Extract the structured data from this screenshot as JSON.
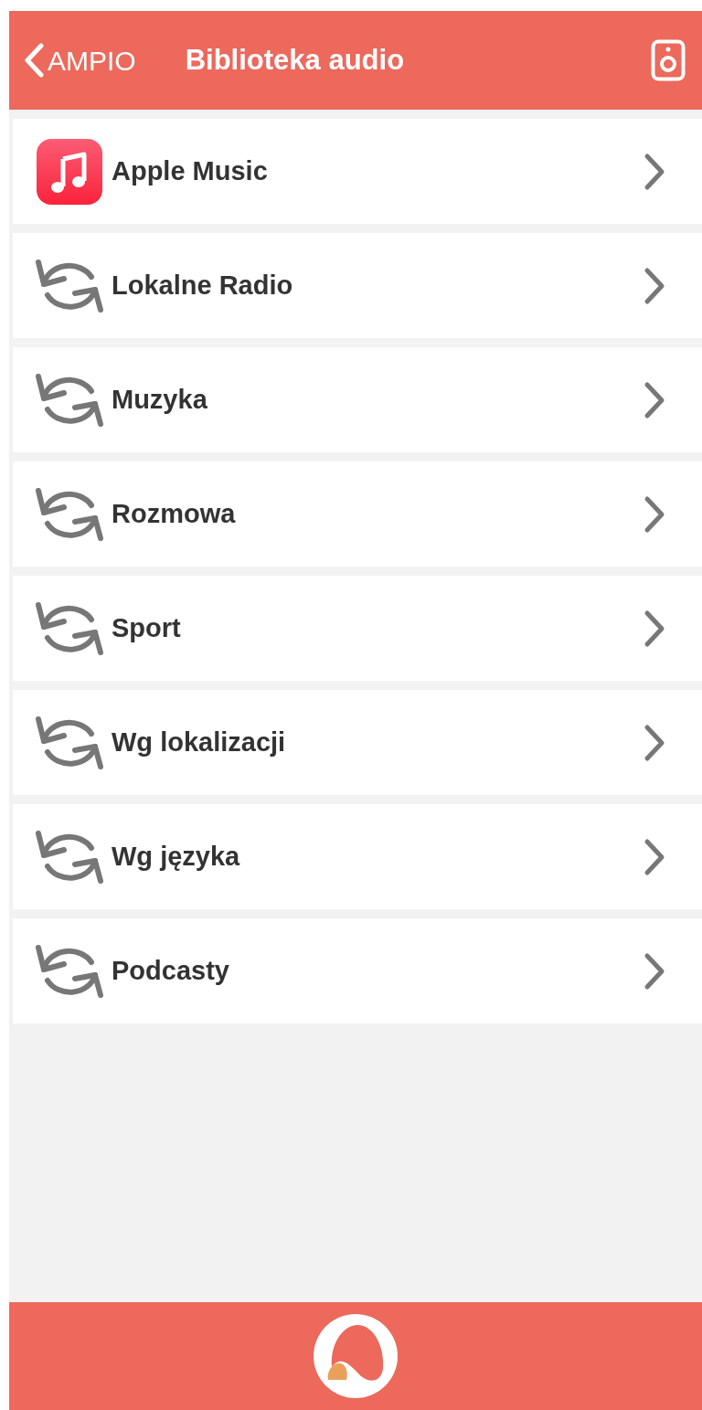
{
  "header": {
    "back_label": "AMPIO",
    "title": "Biblioteka audio"
  },
  "items": [
    {
      "kind": "apple-music",
      "label": "Apple Music"
    },
    {
      "kind": "service",
      "label": "Lokalne Radio"
    },
    {
      "kind": "service",
      "label": "Muzyka"
    },
    {
      "kind": "service",
      "label": "Rozmowa"
    },
    {
      "kind": "service",
      "label": "Sport"
    },
    {
      "kind": "service",
      "label": "Wg lokalizacji"
    },
    {
      "kind": "service",
      "label": "Wg języka"
    },
    {
      "kind": "service",
      "label": "Podcasty"
    }
  ]
}
